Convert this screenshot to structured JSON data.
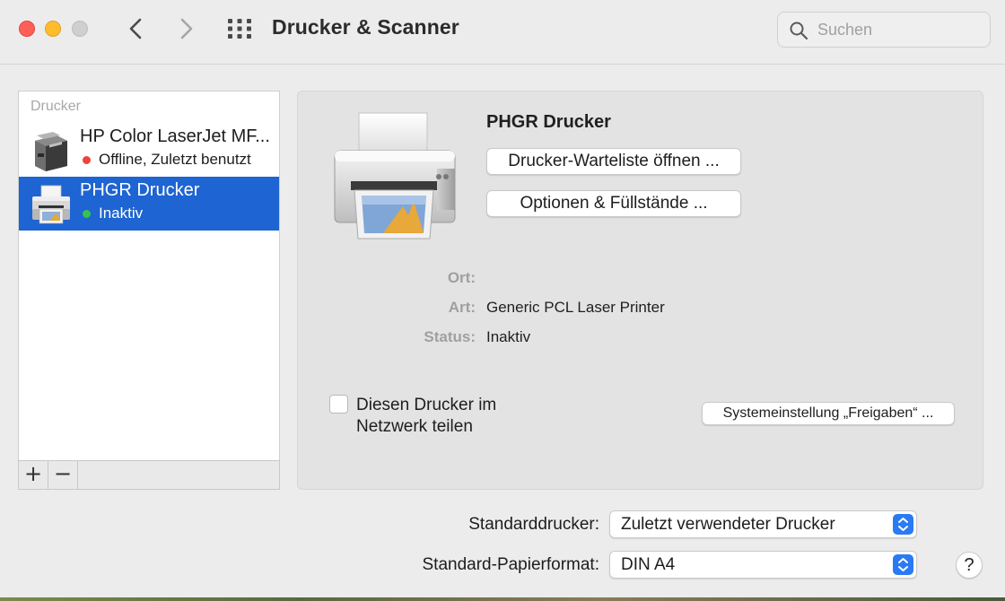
{
  "window": {
    "title": "Drucker & Scanner"
  },
  "toolbar": {
    "back_icon": "chevron-left-icon",
    "forward_icon": "chevron-right-icon",
    "grid_icon": "grid-icon",
    "search": {
      "placeholder": "Suchen",
      "value": ""
    }
  },
  "sidebar": {
    "header": "Drucker",
    "printers": [
      {
        "name": "HP Color LaserJet MF...",
        "status": "Offline, Zuletzt benutzt",
        "status_color": "#f0423a",
        "selected": false
      },
      {
        "name": "PHGR Drucker",
        "status": "Inaktiv",
        "status_color": "#36c24e",
        "selected": true
      }
    ],
    "add_label": "+",
    "remove_label": "−",
    "selection_color": "#1e64d2"
  },
  "detail": {
    "printer_name": "PHGR Drucker",
    "queue_button": "Drucker-Warteliste öffnen ...",
    "options_button": "Optionen & Füllstände ...",
    "info": {
      "location_label": "Ort:",
      "location_value": "",
      "kind_label": "Art:",
      "kind_value": "Generic PCL Laser Printer",
      "status_label": "Status:",
      "status_value": "Inaktiv"
    },
    "share_checkbox": {
      "label_line1": "Diesen Drucker im",
      "label_line2": "Netzwerk teilen",
      "checked": false
    },
    "sharing_button": "Systemeinstellung „Freigaben“ ..."
  },
  "footer": {
    "default_printer_label": "Standarddrucker:",
    "default_printer_value": "Zuletzt verwendeter Drucker",
    "paper_size_label": "Standard-Papierformat:",
    "paper_size_value": "DIN A4",
    "help_label": "?"
  }
}
